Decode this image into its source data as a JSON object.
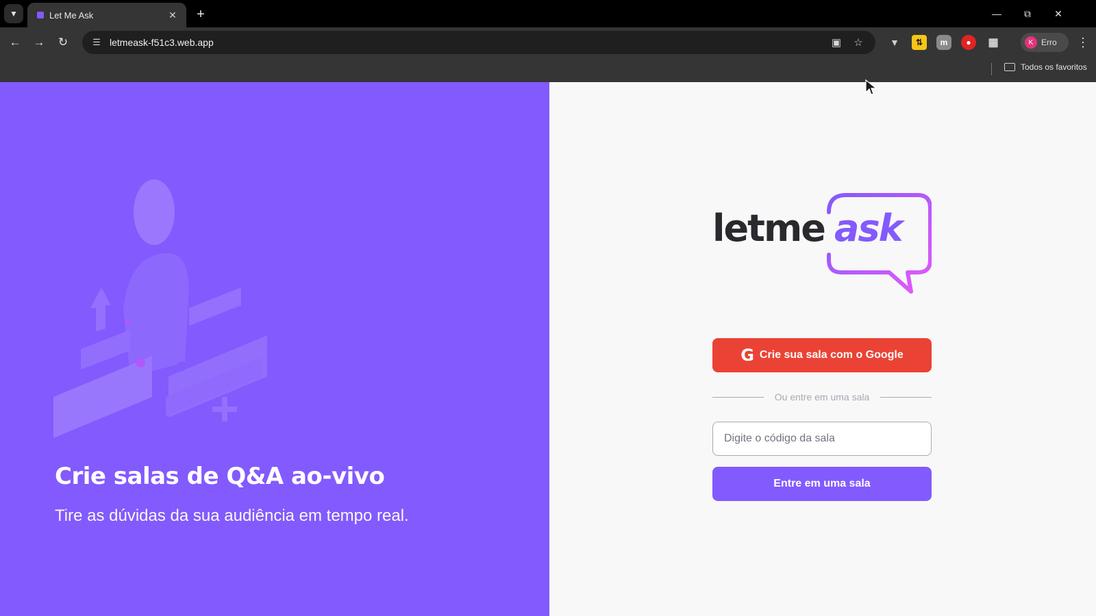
{
  "browser": {
    "tab_title": "Let Me Ask",
    "url": "letmeask-f51c3.web.app",
    "profile_label": "Erro",
    "profile_initial": "K",
    "bookmarks_all_label": "Todos os favoritos",
    "icons": {
      "tab_search": "chevron-down-icon",
      "close_tab": "close-icon",
      "new_tab": "plus-icon",
      "back": "arrow-left-icon",
      "forward": "arrow-right-icon",
      "reload": "reload-icon",
      "site_info": "tune-icon",
      "install": "install-app-icon",
      "bookmark": "star-icon",
      "extensions": "puzzle-icon",
      "menu": "kebab-menu-icon"
    }
  },
  "aside": {
    "title": "Crie salas de Q&A ao-vivo",
    "subtitle": "Tire as dúvidas da sua audiência em tempo real."
  },
  "auth": {
    "logo_part_1": "letme",
    "logo_part_2": "ask",
    "google_button_label": "Crie sua sala com o Google",
    "separator_text": "Ou entre em uma sala",
    "room_input_placeholder": "Digite o código da sala",
    "enter_button_label": "Entre em uma sala"
  },
  "colors": {
    "brand_purple": "#835afd",
    "google_red": "#ea4335",
    "logo_pink": "#e559f9",
    "text_dark": "#29292e",
    "muted": "#a8a8b3"
  }
}
